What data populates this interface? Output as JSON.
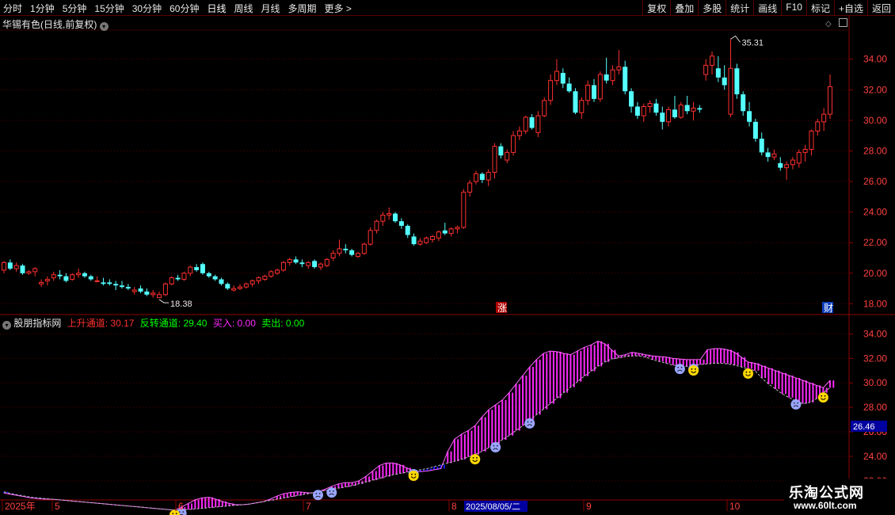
{
  "toolbar": {
    "periods": [
      "分时",
      "1分钟",
      "5分钟",
      "15分钟",
      "30分钟",
      "60分钟",
      "日线",
      "周线",
      "月线",
      "多周期",
      "更多 >"
    ],
    "active_period": "日线",
    "right_buttons": [
      "复权",
      "叠加",
      "多股",
      "统计",
      "画线",
      "F10",
      "标记",
      "+自选",
      "返回"
    ]
  },
  "main_chart": {
    "title": "华锡有色(日线,前复权)",
    "high_label": "35.31",
    "low_label": "18.38",
    "event_label_zhang": "涨",
    "event_label_cai": "财",
    "y_ticks": [
      "34.00",
      "32.00",
      "30.00",
      "28.00",
      "26.00",
      "24.00",
      "22.00",
      "20.00",
      "18.00"
    ]
  },
  "indicator": {
    "name": "股朋指标网",
    "up_channel_label": "上升通道:",
    "up_channel_value": "30.17",
    "reverse_channel_label": "反转通道:",
    "reverse_channel_value": "29.40",
    "buy_label": "买入:",
    "buy_value": "0.00",
    "sell_label": "卖出:",
    "sell_value": "0.00",
    "y_ticks": [
      "34.00",
      "32.00",
      "30.00",
      "28.00",
      "26.00",
      "24.00",
      "22.00"
    ],
    "current_value": "26.46"
  },
  "time_axis": {
    "labels": [
      "2025年",
      "5",
      "6",
      "7",
      "8",
      "9",
      "10"
    ],
    "cursor_date": "2025/08/05/二"
  },
  "watermark": {
    "line1": "乐淘公式网",
    "line2": "www.60lt.com"
  },
  "colors": {
    "up": "#ff3030",
    "down": "#54ffff",
    "up_channel": "#ff28ff",
    "down_channel": "#1414ff",
    "border": "#8b0000"
  },
  "chart_data": {
    "type": "candlestick",
    "period": "日线",
    "ylim": [
      17.4,
      35.9
    ],
    "indicator_ylim": [
      20.5,
      35.0
    ],
    "candles": [
      [
        20.2,
        20.8,
        20.0,
        20.7
      ],
      [
        20.7,
        20.9,
        20.2,
        20.3
      ],
      [
        20.3,
        20.7,
        20.1,
        20.5
      ],
      [
        20.5,
        20.6,
        19.9,
        20.0
      ],
      [
        20.0,
        20.2,
        19.9,
        20.1
      ],
      [
        20.1,
        20.4,
        19.8,
        20.3
      ],
      [
        19.3,
        19.6,
        19.1,
        19.4
      ],
      [
        19.5,
        19.8,
        19.2,
        19.6
      ],
      [
        19.7,
        20.1,
        19.5,
        19.9
      ],
      [
        19.9,
        20.2,
        19.6,
        19.8
      ],
      [
        19.8,
        20.0,
        19.4,
        19.5
      ],
      [
        19.6,
        20.0,
        19.5,
        19.9
      ],
      [
        19.9,
        20.3,
        19.7,
        20.0
      ],
      [
        20.0,
        20.1,
        19.7,
        19.8
      ],
      [
        19.8,
        19.9,
        19.5,
        19.6
      ],
      [
        19.5,
        19.8,
        19.4,
        19.5
      ],
      [
        19.4,
        19.7,
        19.2,
        19.3
      ],
      [
        19.4,
        19.6,
        19.2,
        19.3
      ],
      [
        19.3,
        19.5,
        18.9,
        19.2
      ],
      [
        19.2,
        19.5,
        19.0,
        19.1
      ],
      [
        19.1,
        19.3,
        18.9,
        19.0
      ],
      [
        18.8,
        19.1,
        18.6,
        18.9
      ],
      [
        19.0,
        19.2,
        18.7,
        18.8
      ],
      [
        18.8,
        19.0,
        18.5,
        18.6
      ],
      [
        18.6,
        18.9,
        18.4,
        18.7
      ],
      [
        18.4,
        18.8,
        18.38,
        18.6
      ],
      [
        18.6,
        19.4,
        18.5,
        19.3
      ],
      [
        19.3,
        19.8,
        19.2,
        19.7
      ],
      [
        19.7,
        19.9,
        19.5,
        19.6
      ],
      [
        19.6,
        20.1,
        19.5,
        20.0
      ],
      [
        20.0,
        20.5,
        19.8,
        20.4
      ],
      [
        20.4,
        20.6,
        20.1,
        20.2
      ],
      [
        20.6,
        20.7,
        19.9,
        20.0
      ],
      [
        20.0,
        20.1,
        19.7,
        19.8
      ],
      [
        19.8,
        19.9,
        19.5,
        19.6
      ],
      [
        19.6,
        19.7,
        19.2,
        19.3
      ],
      [
        19.3,
        19.4,
        18.9,
        19.0
      ],
      [
        18.9,
        19.2,
        18.8,
        19.0
      ],
      [
        19.0,
        19.3,
        18.9,
        19.1
      ],
      [
        19.1,
        19.4,
        19.0,
        19.3
      ],
      [
        19.3,
        19.6,
        19.1,
        19.5
      ],
      [
        19.5,
        19.8,
        19.3,
        19.7
      ],
      [
        19.6,
        19.9,
        19.5,
        19.8
      ],
      [
        19.8,
        20.2,
        19.7,
        20.1
      ],
      [
        20.0,
        20.3,
        19.9,
        20.2
      ],
      [
        20.2,
        20.8,
        20.1,
        20.7
      ],
      [
        20.7,
        21.0,
        20.5,
        20.9
      ],
      [
        20.9,
        21.1,
        20.6,
        20.7
      ],
      [
        20.7,
        20.9,
        20.4,
        20.6
      ],
      [
        20.5,
        20.8,
        20.3,
        20.7
      ],
      [
        20.8,
        20.9,
        20.3,
        20.4
      ],
      [
        20.4,
        20.7,
        20.2,
        20.6
      ],
      [
        20.5,
        21.0,
        20.4,
        20.9
      ],
      [
        21.0,
        21.5,
        20.8,
        21.3
      ],
      [
        21.3,
        22.2,
        21.1,
        21.6
      ],
      [
        21.6,
        21.9,
        21.3,
        21.5
      ],
      [
        21.5,
        21.6,
        21.1,
        21.2
      ],
      [
        21.1,
        21.4,
        21.0,
        21.3
      ],
      [
        21.3,
        22.0,
        21.2,
        21.9
      ],
      [
        21.9,
        23.0,
        21.8,
        22.8
      ],
      [
        22.8,
        23.5,
        22.6,
        23.4
      ],
      [
        23.4,
        24.0,
        23.1,
        23.8
      ],
      [
        23.8,
        24.3,
        23.5,
        23.9
      ],
      [
        23.9,
        24.0,
        23.3,
        23.4
      ],
      [
        23.4,
        23.6,
        22.9,
        23.1
      ],
      [
        23.1,
        23.2,
        22.3,
        22.5
      ],
      [
        22.4,
        22.6,
        21.8,
        21.9
      ],
      [
        21.9,
        22.3,
        21.8,
        22.1
      ],
      [
        22.0,
        22.4,
        21.9,
        22.3
      ],
      [
        22.2,
        22.5,
        22.0,
        22.4
      ],
      [
        22.3,
        22.8,
        22.1,
        22.7
      ],
      [
        22.8,
        23.3,
        22.5,
        22.6
      ],
      [
        22.6,
        23.0,
        22.4,
        22.9
      ],
      [
        22.9,
        23.1,
        22.6,
        23.0
      ],
      [
        23.0,
        25.5,
        22.9,
        25.3
      ],
      [
        25.3,
        26.1,
        25.0,
        25.9
      ],
      [
        26.0,
        26.7,
        25.8,
        26.5
      ],
      [
        26.5,
        26.6,
        25.9,
        26.1
      ],
      [
        26.1,
        26.8,
        25.7,
        26.6
      ],
      [
        26.6,
        28.5,
        26.2,
        28.3
      ],
      [
        28.3,
        28.5,
        27.5,
        27.7
      ],
      [
        27.4,
        28.1,
        27.2,
        27.9
      ],
      [
        27.9,
        29.3,
        27.7,
        29.0
      ],
      [
        29.0,
        29.6,
        28.7,
        29.3
      ],
      [
        29.3,
        30.3,
        29.1,
        30.2
      ],
      [
        30.2,
        30.4,
        29.4,
        29.5
      ],
      [
        29.2,
        30.6,
        28.9,
        30.3
      ],
      [
        30.3,
        31.5,
        30.2,
        31.3
      ],
      [
        31.3,
        33.0,
        31.0,
        32.6
      ],
      [
        32.6,
        34.0,
        32.3,
        33.2
      ],
      [
        33.1,
        33.4,
        32.1,
        32.4
      ],
      [
        32.4,
        32.8,
        31.8,
        31.9
      ],
      [
        31.9,
        32.1,
        30.4,
        30.5
      ],
      [
        30.5,
        31.5,
        30.1,
        31.3
      ],
      [
        31.3,
        32.6,
        31.0,
        32.3
      ],
      [
        32.3,
        32.7,
        31.2,
        31.4
      ],
      [
        31.4,
        33.2,
        31.2,
        33.0
      ],
      [
        33.0,
        34.1,
        32.4,
        32.6
      ],
      [
        32.6,
        33.6,
        32.3,
        33.3
      ],
      [
        33.3,
        34.6,
        33.0,
        33.5
      ],
      [
        33.5,
        33.9,
        31.7,
        31.9
      ],
      [
        31.9,
        32.1,
        30.5,
        30.9
      ],
      [
        30.9,
        31.2,
        30.1,
        30.3
      ],
      [
        30.3,
        31.1,
        29.9,
        30.9
      ],
      [
        30.9,
        31.3,
        30.5,
        31.1
      ],
      [
        31.1,
        31.4,
        30.3,
        30.5
      ],
      [
        30.5,
        30.9,
        29.4,
        29.9
      ],
      [
        29.9,
        30.9,
        29.6,
        30.7
      ],
      [
        30.7,
        31.6,
        30.1,
        30.2
      ],
      [
        30.2,
        31.2,
        30.1,
        31.0
      ],
      [
        31.0,
        31.6,
        30.4,
        30.6
      ],
      [
        30.6,
        31.2,
        30.0,
        30.8
      ],
      [
        30.8,
        31.0,
        30.5,
        30.7
      ],
      [
        33.0,
        34.0,
        32.6,
        33.6
      ],
      [
        33.6,
        34.5,
        33.0,
        34.2
      ],
      [
        33.4,
        34.2,
        32.5,
        32.8
      ],
      [
        32.8,
        33.6,
        32.0,
        32.3
      ],
      [
        30.4,
        35.31,
        30.2,
        33.4
      ],
      [
        33.4,
        33.7,
        31.4,
        31.7
      ],
      [
        31.7,
        31.9,
        30.3,
        30.6
      ],
      [
        30.6,
        31.2,
        29.6,
        29.9
      ],
      [
        29.9,
        30.1,
        28.6,
        28.8
      ],
      [
        28.8,
        29.2,
        27.7,
        27.9
      ],
      [
        27.9,
        28.2,
        27.3,
        27.6
      ],
      [
        27.6,
        28.1,
        27.4,
        27.8
      ],
      [
        27.2,
        27.6,
        26.7,
        26.9
      ],
      [
        26.9,
        27.3,
        26.1,
        27.1
      ],
      [
        27.1,
        27.6,
        26.8,
        27.4
      ],
      [
        27.2,
        28.1,
        26.9,
        27.9
      ],
      [
        27.9,
        28.4,
        27.3,
        28.1
      ],
      [
        28.1,
        29.4,
        27.7,
        29.3
      ],
      [
        29.3,
        30.1,
        29.0,
        29.9
      ],
      [
        29.9,
        30.8,
        29.3,
        30.4
      ],
      [
        30.4,
        33.0,
        30.1,
        32.2
      ]
    ],
    "channel_upper": [
      21.0,
      20.9,
      20.8,
      20.7,
      20.6,
      20.55,
      20.5,
      20.5,
      20.45,
      20.4,
      20.35,
      20.3,
      20.25,
      20.2,
      20.15,
      20.1,
      20.05,
      20.0,
      19.95,
      19.9,
      19.85,
      19.8,
      19.75,
      19.7,
      19.65,
      19.6,
      19.85,
      20.15,
      20.45,
      20.6,
      20.65,
      20.5,
      20.3,
      20.15,
      20.05,
      20.05,
      20.1,
      20.2,
      20.3,
      20.5,
      20.75,
      20.95,
      21.05,
      21.1,
      21.05,
      21.0,
      21.1,
      21.3,
      21.55,
      21.75,
      21.85,
      21.85,
      22.0,
      22.35,
      22.8,
      23.25,
      23.45,
      23.45,
      23.3,
      23.05,
      22.8,
      22.75,
      22.8,
      22.9,
      23.0,
      24.4,
      25.4,
      25.8,
      26.1,
      26.5,
      27.2,
      27.8,
      28.2,
      28.6,
      29.2,
      29.9,
      30.6,
      31.3,
      31.9,
      32.4,
      32.6,
      32.55,
      32.4,
      32.3,
      32.6,
      32.9,
      33.1,
      33.4,
      33.2,
      32.7,
      32.2,
      32.3,
      32.5,
      32.4,
      32.3,
      32.2,
      32.15,
      32.1,
      32.0,
      31.95,
      31.9,
      31.9,
      31.9,
      32.7,
      32.8,
      32.8,
      32.7,
      32.5,
      32.1,
      31.7,
      31.6,
      31.4,
      31.2,
      31.0,
      30.8,
      30.6,
      30.4,
      30.2,
      30.0,
      29.8,
      29.6,
      30.2
    ],
    "channel_lower": [
      21.1,
      20.95,
      20.85,
      20.75,
      20.65,
      20.6,
      20.55,
      20.5,
      20.45,
      20.4,
      20.35,
      20.3,
      20.25,
      20.2,
      20.15,
      20.1,
      20.05,
      20.0,
      19.95,
      19.9,
      19.85,
      19.8,
      19.75,
      19.7,
      19.65,
      19.6,
      19.6,
      19.65,
      19.7,
      19.75,
      19.8,
      19.85,
      19.9,
      19.95,
      20.0,
      20.05,
      20.1,
      20.2,
      20.3,
      20.4,
      20.5,
      20.6,
      20.7,
      20.8,
      20.9,
      21.0,
      21.1,
      21.2,
      21.3,
      21.4,
      21.5,
      21.6,
      21.75,
      21.9,
      22.05,
      22.2,
      22.35,
      22.5,
      22.6,
      22.7,
      22.8,
      22.9,
      23.0,
      23.15,
      23.3,
      23.45,
      23.6,
      23.75,
      23.95,
      24.15,
      24.4,
      24.7,
      25.0,
      25.35,
      25.7,
      26.1,
      26.5,
      26.95,
      27.4,
      27.85,
      28.3,
      28.75,
      29.2,
      29.65,
      30.1,
      30.55,
      30.95,
      31.35,
      31.7,
      31.95,
      32.05,
      32.15,
      32.2,
      32.2,
      32.1,
      31.9,
      31.75,
      31.6,
      31.45,
      31.4,
      31.35,
      31.4,
      31.5,
      31.55,
      31.6,
      31.6,
      31.55,
      31.45,
      31.3,
      31.15,
      31.0,
      30.4,
      29.9,
      29.5,
      29.1,
      28.8,
      28.5,
      28.3,
      28.4,
      28.7,
      29.2,
      29.6
    ],
    "signals_sell_idx": [
      26,
      46,
      48,
      60,
      72,
      77,
      99,
      101,
      116
    ],
    "signals_buy_idx": [
      25,
      60,
      69,
      101,
      109,
      120
    ]
  }
}
